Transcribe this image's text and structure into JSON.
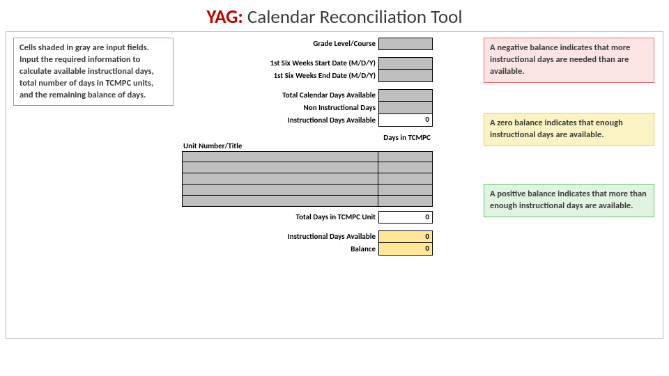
{
  "title_prefix": "YAG:",
  "title_rest": " Calendar Reconciliation Tool",
  "info_left": "Cells shaded in gray are input fields. Input the required information to calculate available instructional days, total number of days in TCMPC units, and the remaining balance of days.",
  "info_neg": "A negative balance indicates that more instructional days are needed than are available.",
  "info_zero": "A zero balance indicates that enough instructional days are available.",
  "info_pos": "A positive balance indicates that more than enough instructional days are available.",
  "labels": {
    "grade": "Grade Level/Course",
    "start": "1st Six Weeks Start Date (M/D/Y)",
    "end": "1st Six Weeks End Date (M/D/Y)",
    "total_cal": "Total Calendar Days Available",
    "non_instr": "Non Instructional Days",
    "instr_avail": "Instructional Days Available",
    "unit_title": "Unit Number/Title",
    "days_tcmpc": "Days in TCMPC",
    "total_tcmpc": "Total Days in TCMPC Unit",
    "instr_avail2": "Instructional Days Available",
    "balance": "Balance"
  },
  "values": {
    "grade": "",
    "start": "",
    "end": "",
    "total_cal": "",
    "non_instr": "",
    "instr_avail": "0",
    "total_tcmpc": "0",
    "instr_avail2": "0",
    "balance": "0"
  },
  "unit_rows": [
    "",
    "",
    "",
    "",
    ""
  ]
}
